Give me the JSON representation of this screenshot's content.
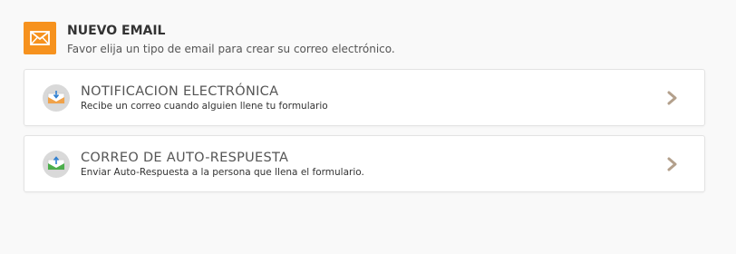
{
  "header": {
    "icon": "envelope-icon",
    "title": "NUEVO EMAIL",
    "subtitle": "Favor elija un tipo de email para crear su correo electrónico."
  },
  "options": [
    {
      "icon": "notification-email-icon",
      "title": "NOTIFICACION ELECTRÓNICA",
      "description": "Recibe un correo cuando alguien llene tu formulario"
    },
    {
      "icon": "autoresponse-email-icon",
      "title": "CORREO DE AUTO-RESPUESTA",
      "description": "Enviar Auto-Respuesta a la persona que llena el formulario."
    }
  ],
  "colors": {
    "accent": "#f6921e",
    "notification_envelope": "#f0a24a",
    "autoresponse_envelope": "#4cae4c",
    "arrow_blue": "#2f7fd0",
    "chevron": "#b3a08c"
  }
}
